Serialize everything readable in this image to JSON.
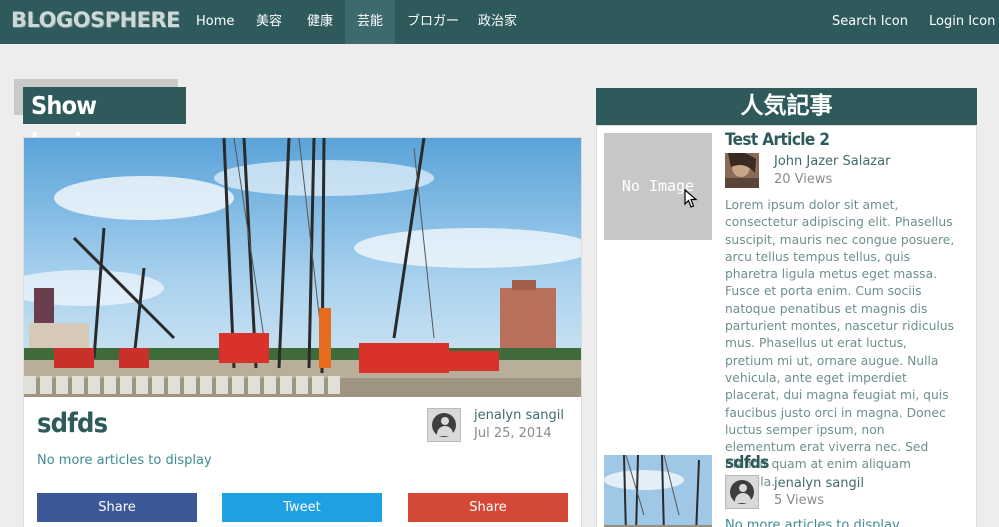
{
  "nav": {
    "logo": "BLOGOSPHERE",
    "items": [
      "Home",
      "美容",
      "健康",
      "芸能",
      "ブロガー",
      "政治家"
    ],
    "active_index": 3,
    "search": "Search Icon",
    "login": "Login Icon"
  },
  "section": {
    "title": "Show business"
  },
  "article": {
    "title": "sdfds",
    "author": "jenalyn sangil",
    "date": "Jul 25, 2014",
    "no_more": "No more articles to display",
    "share_buttons": [
      {
        "label": "Share",
        "color": "#3b5998"
      },
      {
        "label": "Tweet",
        "color": "#1da1e2"
      },
      {
        "label": "Share",
        "color": "#d34836"
      }
    ]
  },
  "sidebar": {
    "title": "人気記事",
    "items": [
      {
        "no_image": "No Image",
        "title": "Test Article 2",
        "author": "John Jazer Salazar",
        "views": "20 Views",
        "excerpt": "Lorem ipsum dolor sit amet, consectetur adipiscing elit. Phasellus suscipit, mauris nec congue posuere, arcu tellus tempus tellus, quis pharetra ligula metus eget massa. Fusce et porta enim. Cum sociis natoque penatibus et magnis dis parturient montes, nascetur ridiculus mus. Phasellus ut erat luctus, pretium mi ut, ornare augue. Nulla vehicula, ante eget imperdiet placerat, dui magna feugiat mi, quis faucibus justo orci in magna. Donec luctus semper ipsum, non elementum erat viverra nec. Sed blandit quam at enim aliquam fringilla."
      },
      {
        "title": "sdfds",
        "author": "jenalyn sangil",
        "views": "5 Views",
        "no_more": "No more articles to display"
      }
    ]
  },
  "colors": {
    "brand": "#2e5a5c",
    "page_bg": "#ededed",
    "link": "#3f8a94"
  },
  "icons": [
    "user-avatar-icon",
    "mouse-pointer-icon"
  ]
}
